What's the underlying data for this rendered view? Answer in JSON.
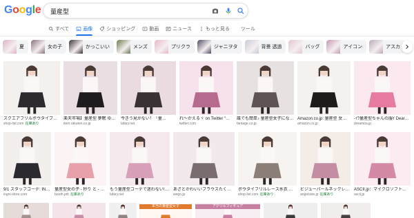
{
  "logo": {
    "letters": [
      "G",
      "o",
      "o",
      "g",
      "l",
      "e"
    ],
    "colors": [
      "#4285f4",
      "#ea4335",
      "#fbbc05",
      "#4285f4",
      "#34a853",
      "#ea4335"
    ]
  },
  "search": {
    "value": "量産型",
    "icons": [
      "camera-icon",
      "mic-icon",
      "search-icon"
    ]
  },
  "tabs": [
    {
      "label": "すべて",
      "icon": "search-icon",
      "active": false
    },
    {
      "label": "画像",
      "icon": "image-icon",
      "active": true
    },
    {
      "label": "ショッピング",
      "icon": "tag-icon",
      "active": false
    },
    {
      "label": "動画",
      "icon": "video-icon",
      "active": false
    },
    {
      "label": "ニュース",
      "icon": "news-icon",
      "active": false
    },
    {
      "label": "もっと見る",
      "icon": "more-icon",
      "active": false
    },
    {
      "label": "ツール",
      "icon": "",
      "active": false
    }
  ],
  "chips": [
    {
      "label": "夏",
      "color": "#d9b3c5"
    },
    {
      "label": "女の子",
      "color": "#8a6f7d"
    },
    {
      "label": "かっこいい",
      "color": "#3a3437"
    },
    {
      "label": "メンズ",
      "color": "#6b7a4e"
    },
    {
      "label": "プリクラ",
      "color": "#e6b8c8"
    },
    {
      "label": "ジャニヲタ",
      "color": "#4f4b63"
    },
    {
      "label": "背景 透過",
      "color": "#c9c9d6"
    },
    {
      "label": "バッグ",
      "color": "#e3c7d2"
    },
    {
      "label": "アイコン",
      "color": "#c497b2"
    },
    {
      "label": "アスカ",
      "color": "#b9a9b8"
    }
  ],
  "row1": [
    {
      "caption": "スクエアフリルボウタイブラウス…",
      "source": "shop-list.com",
      "badge": "在庫あり",
      "c1": "#f3f0ee",
      "c2": "#2d2b2f"
    },
    {
      "caption": "楽天市場】量産型 夢眠 ゆめかわ…",
      "source": "item.rakuten.co.jp",
      "badge": "",
      "c1": "#e9dfe3",
      "c2": "#1f1c20"
    },
    {
      "caption": "今きう見かない！「量…",
      "source": "lafary.net",
      "badge": "",
      "c1": "#eadbe0",
      "c2": "#3a3134"
    },
    {
      "caption": "れ〜かえるヾ on Twitter \"…",
      "source": "twitter.com",
      "badge": "",
      "c1": "#f7e1ec",
      "c2": "#b56a8e"
    },
    {
      "caption": "誰でも簡単♪ 量産型女子になる…",
      "source": "fantage.co.jp",
      "badge": "",
      "c1": "#e7e1e1",
      "c2": "#5f5356"
    },
    {
      "caption": "Amazon.co.jp: 量産型 女子…",
      "source": "amazon.co.jp",
      "badge": "",
      "c1": "#f4f1ee",
      "c2": "#1e1c1b"
    },
    {
      "caption": "-ｲﾗ量産型ちゃんの服ｲ DearMy…",
      "source": "dreamoa.jp",
      "badge": "",
      "c1": "#fbe9ef",
      "c2": "#e67aa0"
    }
  ],
  "row2": [
    {
      "caption": "9/1 スタッフコーデ: IN…",
      "source": "ingni-store.com",
      "badge": "",
      "c1": "#f2efed",
      "c2": "#2a2a30"
    },
    {
      "caption": "量産型女の子 - 秒り と - BOOTH",
      "source": "booth.pm",
      "badge": "在庫あり",
      "c1": "#fcf3f4",
      "c2": "#e8a0ab"
    },
    {
      "caption": "もう量産型コーデで迷わない!…",
      "source": "lafary.net",
      "badge": "",
      "c1": "#f6e9ee",
      "c2": "#d8a0b8"
    },
    {
      "caption": "あざとかわいいブラウスたくさん…",
      "source": "wego.jp",
      "badge": "",
      "c1": "#f1e9ec",
      "c2": "#7a6d70"
    },
    {
      "caption": "ボウタイフリルレース水衣 量産型…",
      "source": "shop-list.com",
      "badge": "在庫あり",
      "c1": "#f7f3f0",
      "c2": "#8b7f78"
    },
    {
      "caption": "ビジューパールネックレス付…",
      "source": "angelsize.jp",
      "badge": "在庫あり",
      "c1": "#f3ece7",
      "c2": "#c48da3"
    },
    {
      "caption": "ASCII.jp：マイクロソフト…",
      "source": "ascii.jp",
      "badge": "",
      "c1": "#fcebf1",
      "c2": "#d48aa6"
    }
  ],
  "row3": [
    {
      "caption": "",
      "source": "",
      "badge": "",
      "c1": "#e5dcd9",
      "c2": "#a59290"
    },
    {
      "caption": "",
      "source": "",
      "badge": "",
      "c1": "#f4e4ea",
      "c2": "#c98ea7"
    },
    {
      "caption": "",
      "source": "",
      "badge": "",
      "c1": "#f1f0f0",
      "c2": "#8f8384"
    },
    {
      "caption": "本当の量産型女子",
      "source": "",
      "badge": "",
      "c1": "#fff7f1",
      "c2": "#e07b2e"
    },
    {
      "caption": "アクリルフィギュア",
      "source": "",
      "badge": "",
      "c1": "#f7eef3",
      "c2": "#c77fa2"
    },
    {
      "caption": "",
      "source": "",
      "badge": "",
      "c1": "#eeeeee",
      "c2": "#3b3b3b"
    },
    {
      "caption": "",
      "source": "",
      "badge": "",
      "c1": "#f1edec",
      "c2": "#4a4142"
    }
  ],
  "colors": {
    "accent": "#1a73e8",
    "chip_bg": "#f1f3f4",
    "badge": "#188038"
  }
}
